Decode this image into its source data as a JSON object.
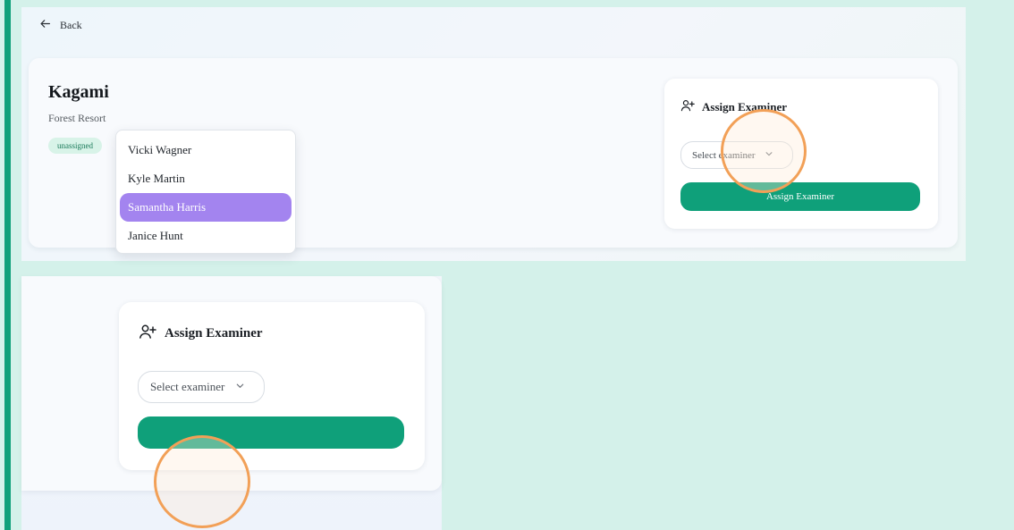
{
  "nav": {
    "back_label": "Back"
  },
  "property": {
    "name": "Kagami",
    "subtitle": "Forest Resort",
    "status_badge": "unassigned"
  },
  "assign_panel": {
    "title": "Assign Examiner",
    "select_placeholder": "Select examiner",
    "button_label": "Assign Examiner"
  },
  "zoomed_panel": {
    "title": "Assign Examiner",
    "select_placeholder": "Select examiner",
    "dropdown_options": [
      "Vicki Wagner",
      "Kyle Martin",
      "Samantha Harris",
      "Janice Hunt"
    ],
    "selected_option": "Samantha Harris"
  },
  "colors": {
    "accent": "#0fa07a",
    "highlight_option": "#a384ef",
    "focus_ring": "#f2a057",
    "background": "#d4f1ea"
  },
  "icons": {
    "back": "arrow-left-icon",
    "assign": "user-plus-icon",
    "select": "chevron-down-icon"
  }
}
